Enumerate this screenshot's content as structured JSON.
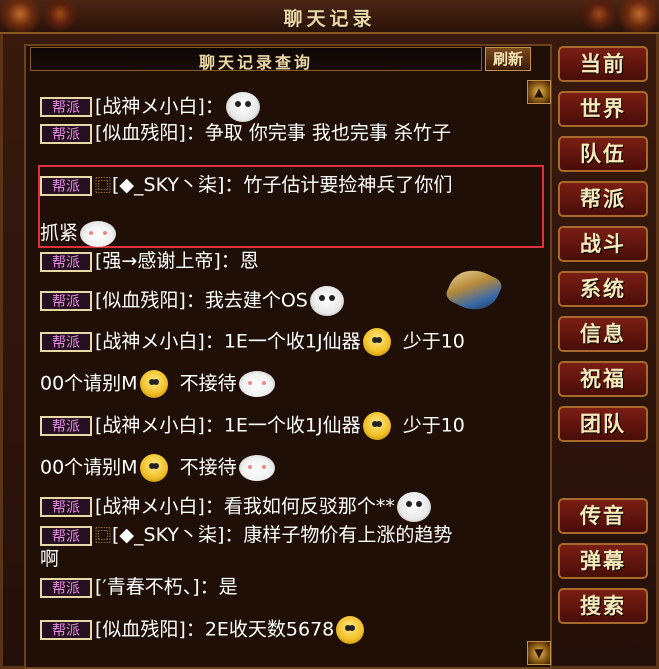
{
  "window": {
    "title": "聊天记录"
  },
  "panel": {
    "title": "聊天记录查询",
    "refresh_label": "刷新"
  },
  "badge_label": "帮派",
  "tabs": [
    "当前",
    "世界",
    "队伍",
    "帮派",
    "战斗",
    "系统",
    "信息",
    "祝福",
    "团队",
    "传音",
    "弹幕",
    "搜索"
  ],
  "messages": [
    {
      "speaker": "[战神メ小白]：",
      "text": "",
      "emoticon": "panda-face"
    },
    {
      "speaker": "[似血残阳]：",
      "text": "争取 你完事 我也完事 杀竹子"
    },
    {
      "speaker": "[◆_SKY丶柒]：",
      "text": "竹子估计要捡神兵了你们",
      "cont": "抓紧",
      "cont_emoticon": "bunny-face",
      "marker": "⿴",
      "highlighted": true
    },
    {
      "speaker": "[强→感谢上帝]：",
      "text": "恩"
    },
    {
      "speaker": "[似血残阳]：",
      "text": "我去建个OS",
      "emoticon": "panda-face"
    },
    {
      "speaker": "[战神メ小白]：",
      "text": "1E一个收1J仙器",
      "emoticon": "shocked-face",
      "text2": "少于10",
      "cont": "00个请别M",
      "cont2": "不接待",
      "cont_emoticon": "shocked-face",
      "cont_emoticon2": "bunny-face"
    },
    {
      "speaker": "[战神メ小白]：",
      "text": "1E一个收1J仙器",
      "emoticon": "shocked-face",
      "text2": "少于10",
      "cont": "00个请别M",
      "cont2": "不接待",
      "cont_emoticon": "shocked-face",
      "cont_emoticon2": "bunny-face"
    },
    {
      "speaker": "[战神メ小白]：",
      "text": "看我如何反驳那个**",
      "emoticon": "panda-face"
    },
    {
      "speaker": "[◆_SKY丶柒]：",
      "text": "康样子物价有上涨的趋势",
      "cont": "啊",
      "marker": "⿴"
    },
    {
      "speaker": "[′青春不朽、]：",
      "text": "是"
    },
    {
      "speaker": "[似血残阳]：",
      "text": "2E收天数5678",
      "emoticon": "worried-face"
    }
  ]
}
